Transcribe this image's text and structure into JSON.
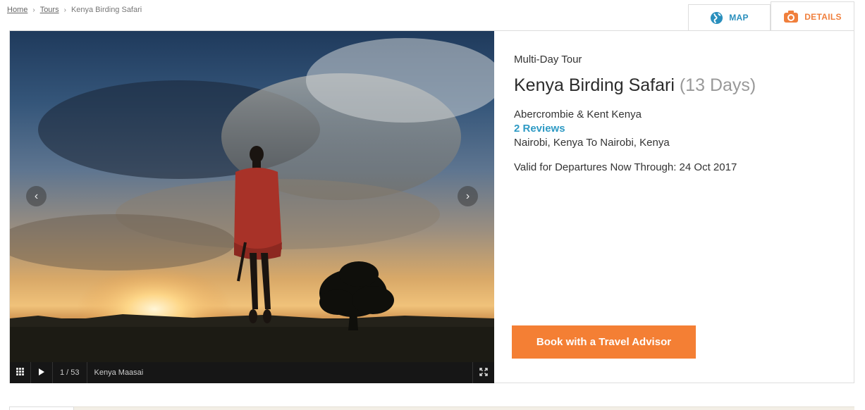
{
  "breadcrumb": {
    "home": "Home",
    "tours": "Tours",
    "current": "Kenya Birding Safari"
  },
  "tabs": {
    "map": "MAP",
    "details": "DETAILS"
  },
  "gallery": {
    "counter": "1 / 53",
    "caption": "Kenya Maasai"
  },
  "tour": {
    "type": "Multi-Day Tour",
    "name": "Kenya Birding Safari",
    "duration": "(13 Days)",
    "operator": "Abercrombie & Kent Kenya",
    "reviews": "2 Reviews",
    "route": "Nairobi, Kenya To Nairobi, Kenya",
    "validity": "Valid for Departures Now Through: 24 Oct 2017"
  },
  "cta": {
    "book_label": "Book with a Travel Advisor"
  },
  "colors": {
    "accent": "#f47f34",
    "link": "#2e9ac4"
  }
}
